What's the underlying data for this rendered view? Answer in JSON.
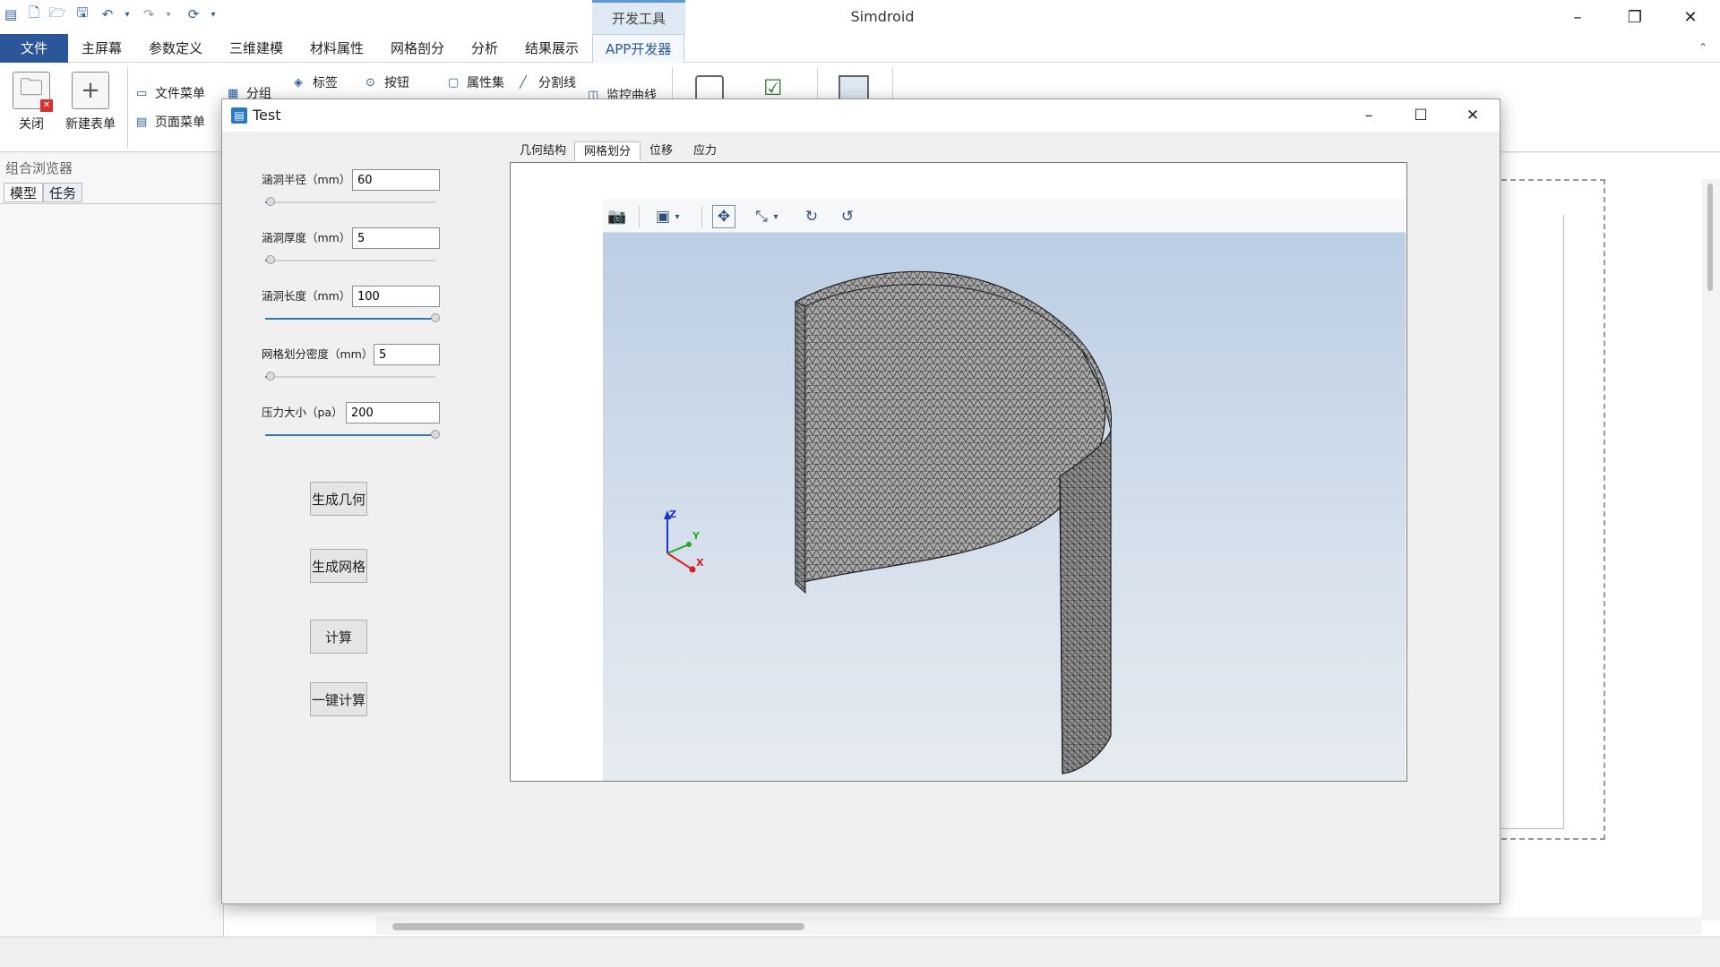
{
  "app": {
    "title": "Simdroid",
    "context_tab": "开发工具",
    "window_controls": {
      "minimize": "–",
      "restore": "❐",
      "close": "✕"
    }
  },
  "quick_access": [
    "app-icon",
    "new-icon",
    "open-icon",
    "save-icon",
    "undo-icon",
    "redo-icon",
    "refresh-icon"
  ],
  "menu": {
    "file": "文件",
    "items": [
      "主屏幕",
      "参数定义",
      "三维建模",
      "材料属性",
      "网格剖分",
      "分析",
      "结果展示",
      "APP开发器"
    ]
  },
  "ribbon": {
    "close": "关闭",
    "new_form": "新建表单",
    "file_menu": "文件菜单",
    "page_menu": "页面菜单",
    "group": "分组",
    "label": "标签",
    "button": "按钮",
    "property_set": "属性集",
    "divider": "分割线",
    "monitor_curve": "监控曲线"
  },
  "left_panel": {
    "title": "组合浏览器",
    "tabs": [
      "模型",
      "任务"
    ]
  },
  "dialog": {
    "title": "Test",
    "params": [
      {
        "label": "涵洞半径（mm）",
        "value": "60",
        "slider": 0.03
      },
      {
        "label": "涵洞厚度（mm）",
        "value": "5",
        "slider": 0.03
      },
      {
        "label": "涵洞长度（mm）",
        "value": "100",
        "slider": 1.0
      },
      {
        "label": "网格划分密度（mm）",
        "value": "5",
        "slider": 0.03
      },
      {
        "label": "压力大小（pa）",
        "value": "200",
        "slider": 1.0
      }
    ],
    "buttons": [
      "生成几何",
      "生成网格",
      "计算",
      "一键计算"
    ],
    "view_tabs": [
      "几何结构",
      "网格划分",
      "位移",
      "应力"
    ],
    "active_tab": "网格划分",
    "triad": {
      "z": "Z",
      "y": "Y",
      "x": "X"
    }
  }
}
